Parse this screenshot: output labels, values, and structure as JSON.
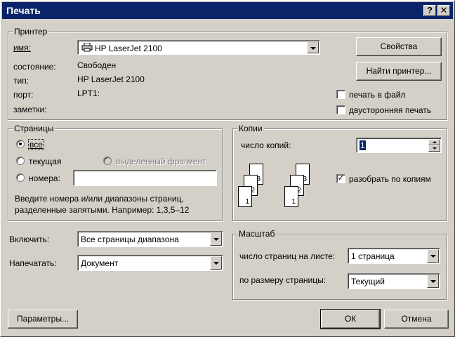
{
  "title": "Печать",
  "titlebar": {
    "help_label": "?",
    "close_label": "✕"
  },
  "printer": {
    "group_label": "Принтер",
    "name_label": "имя:",
    "name_value": "HP LaserJet 2100",
    "properties_button": "Свойства",
    "find_button": "Найти принтер...",
    "status_label": "состояние:",
    "status_value": "Свободен",
    "type_label": "тип:",
    "type_value": "HP LaserJet 2100",
    "port_label": "порт:",
    "port_value": "LPT1:",
    "notes_label": "заметки:",
    "print_to_file_label": "печать в файл",
    "print_to_file_checked": false,
    "duplex_label": "двусторонняя печать",
    "duplex_checked": false
  },
  "pages": {
    "group_label": "Страницы",
    "all_label": "все",
    "current_label": "текущая",
    "selection_label": "выделенный фрагмент",
    "numbers_label": "номера:",
    "numbers_value": "",
    "selected": "all",
    "hint_line1": "Введите номера и/или диапазоны страниц,",
    "hint_line2": "разделенные запятыми. Например: 1,3,5–12"
  },
  "copies": {
    "group_label": "Копии",
    "count_label": "число копий:",
    "count_value": "1",
    "collate_label": "разобрать по копиям",
    "collate_checked": true,
    "page_numbers": [
      "1",
      "2",
      "3"
    ]
  },
  "include": {
    "label": "Включить:",
    "value": "Все страницы диапазона"
  },
  "print_what": {
    "label": "Напечатать:",
    "value": "Документ"
  },
  "zoom": {
    "group_label": "Масштаб",
    "pages_per_sheet_label": "число страниц на листе:",
    "pages_per_sheet_value": "1 страница",
    "scale_to_label": "по размеру страницы:",
    "scale_to_value": "Текущий"
  },
  "buttons": {
    "options": "Параметры...",
    "ok": "ОК",
    "cancel": "Отмена"
  },
  "icons": {
    "printer": "printer-icon",
    "close": "close-icon",
    "help": "help-icon"
  },
  "colors": {
    "titlebar": "#0a246a",
    "face": "#d4d0c8"
  }
}
